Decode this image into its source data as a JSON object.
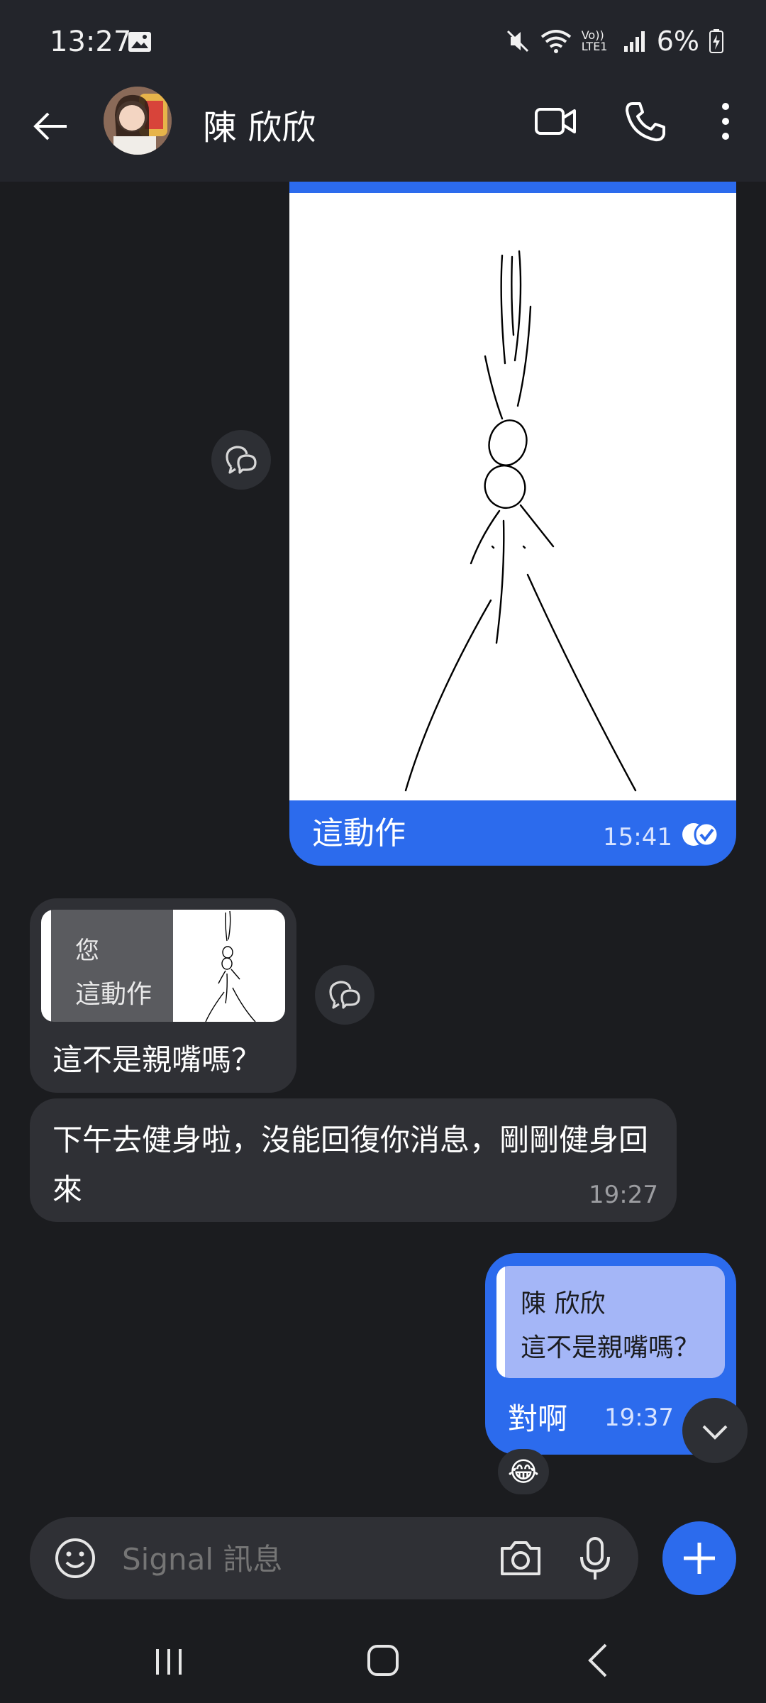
{
  "status_bar": {
    "time": "13:27",
    "network_label": "Vo)) LTE1",
    "battery": "6%"
  },
  "header": {
    "contact_name": "陳 欣欣",
    "icons": [
      "back-arrow-icon",
      "video-call-icon",
      "phone-icon",
      "more-vert-icon"
    ]
  },
  "messages": {
    "sent_image": {
      "caption": "這動作",
      "time": "15:41",
      "status": "read"
    },
    "received_quote": {
      "quote_author": "您",
      "quote_text": "這動作",
      "text": "這不是親嘴嗎？"
    },
    "received_long": {
      "text": "下午去健身啦，沒能回復你消息，剛剛健身回來",
      "time": "19:27"
    },
    "sent_reply": {
      "quote_author": "陳 欣欣",
      "quote_text": "這不是親嘴嗎？",
      "text": "對啊",
      "time": "19:37",
      "reaction": "😂"
    }
  },
  "composer": {
    "placeholder": "Signal 訊息"
  },
  "colors": {
    "accent": "#2c6bed",
    "background": "#1b1c1f",
    "bar": "#23252b",
    "incoming_bubble": "#2f3035"
  }
}
